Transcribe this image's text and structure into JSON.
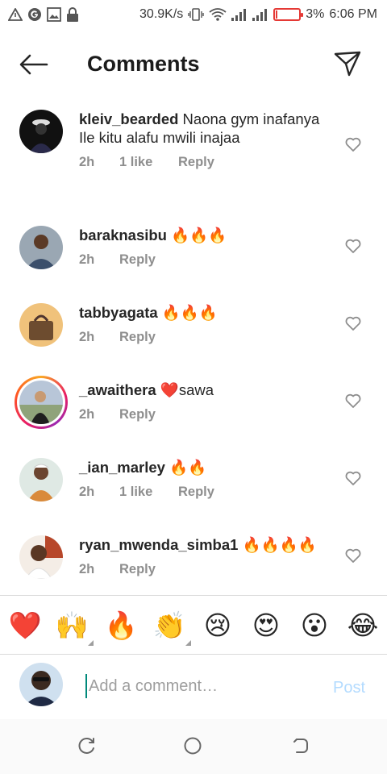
{
  "status_bar": {
    "network_speed": "30.9K/s",
    "battery_percent": "3%",
    "battery_level": 0.03,
    "time": "6:06 PM",
    "icons": [
      "alert-icon",
      "google-icon",
      "gallery-icon",
      "lock-icon",
      "vibrate-icon",
      "wifi-icon",
      "signal-icon",
      "signal-icon",
      "battery-icon"
    ]
  },
  "header": {
    "title": "Comments",
    "back_icon": "back-arrow-icon",
    "send_icon": "send-icon"
  },
  "comments": [
    {
      "username": "kleiv_bearded",
      "text": " Naona gym inafanya Ile kitu alafu mwili inajaa",
      "time": "2h",
      "likes": "1 like",
      "reply": "Reply",
      "avatar": "avatar-dark"
    },
    {
      "username": "baraknasibu",
      "text": " 🔥🔥🔥",
      "time": "2h",
      "likes": "",
      "reply": "Reply",
      "avatar": "avatar-man"
    },
    {
      "username": "tabbyagata",
      "text": " 🔥🔥🔥",
      "time": "2h",
      "likes": "",
      "reply": "Reply",
      "avatar": "avatar-bag"
    },
    {
      "username": "_awaithera",
      "text": " ❤️sawa",
      "time": "2h",
      "likes": "",
      "reply": "Reply",
      "avatar": "avatar-story"
    },
    {
      "username": "_ian_marley",
      "text": " 🔥🔥",
      "time": "2h",
      "likes": "1 like",
      "reply": "Reply",
      "avatar": "avatar-boy"
    },
    {
      "username": "ryan_mwenda_simba1",
      "text": " 🔥🔥🔥🔥",
      "time": "2h",
      "likes": "",
      "reply": "Reply",
      "avatar": "avatar-kid"
    }
  ],
  "emoji_bar": [
    {
      "char": "❤️",
      "name": "red-heart-emoji",
      "has_variants": false
    },
    {
      "char": "🙌",
      "name": "raising-hands-emoji",
      "has_variants": true
    },
    {
      "char": "🔥",
      "name": "fire-emoji",
      "has_variants": false
    },
    {
      "char": "👏",
      "name": "clapping-hands-emoji",
      "has_variants": true
    },
    {
      "char": "😢",
      "name": "crying-face-emoji",
      "has_variants": false
    },
    {
      "char": "😍",
      "name": "heart-eyes-emoji",
      "has_variants": false
    },
    {
      "char": "😮",
      "name": "surprised-face-emoji",
      "has_variants": false
    },
    {
      "char": "😂",
      "name": "tears-of-joy-emoji",
      "has_variants": false
    }
  ],
  "composer": {
    "placeholder": "Add a comment…",
    "post_label": "Post"
  },
  "nav_bar": {
    "icons": [
      "recents-icon",
      "home-icon",
      "back-icon"
    ]
  },
  "colors": {
    "text": "#262626",
    "meta": "#8e8e8e",
    "post_disabled": "#b3dbff",
    "battery_low": "#e53935"
  }
}
